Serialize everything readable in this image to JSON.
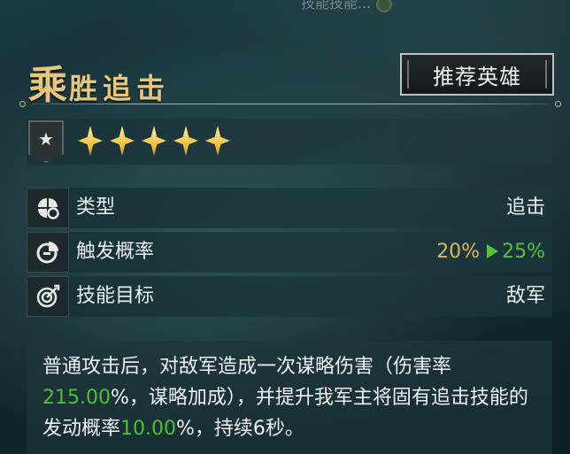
{
  "top_partial_text": "技能技能...",
  "skill": {
    "title_first": "乘",
    "title_rest": "胜追击",
    "recommend_button": "推荐英雄",
    "rank_icon": "star-icon",
    "stars_filled": 5
  },
  "attributes": [
    {
      "icon": "clover-icon",
      "label": "类型",
      "value": "追击"
    },
    {
      "icon": "pie-chart-icon",
      "label": "触发概率",
      "value_from": "20%",
      "value_to": "25%"
    },
    {
      "icon": "target-icon",
      "label": "技能目标",
      "value": "敌军"
    }
  ],
  "description": {
    "part1": "普通攻击后，对敌军造成一次谋略伤害（伤害率",
    "num1": "215.00",
    "part2": "%，谋略加成），并提升我军主将固有追击技能的发动概率",
    "num2": "10.00",
    "part3": "%，持续6秒。"
  },
  "colors": {
    "title_gold": "#e7c57a",
    "highlight_green": "#57c23a",
    "value_gold": "#e0b65a"
  }
}
